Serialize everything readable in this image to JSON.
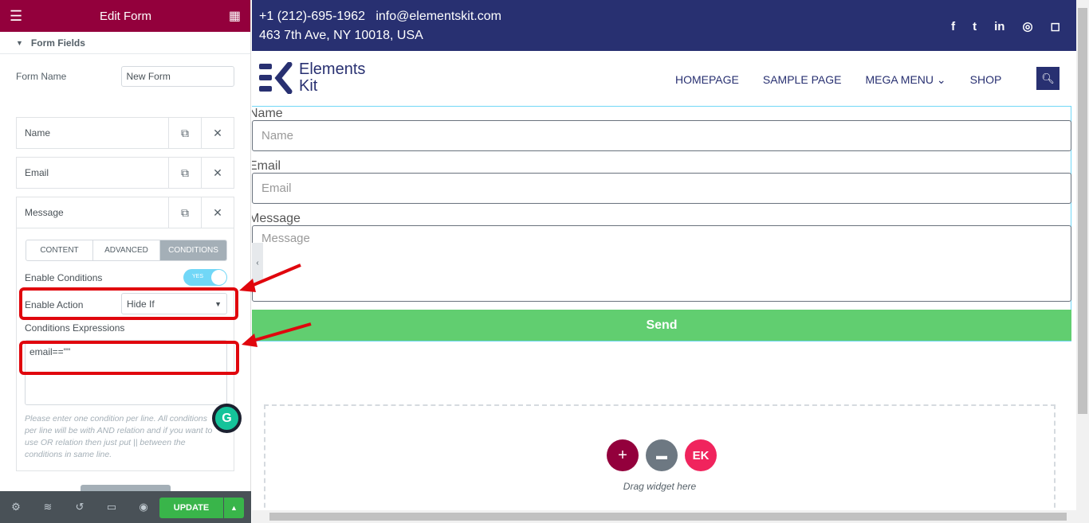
{
  "panel": {
    "title": "Edit Form",
    "section": "Form Fields",
    "form_name_label": "Form Name",
    "form_name_value": "New Form",
    "items": [
      {
        "label": "Name"
      },
      {
        "label": "Email"
      },
      {
        "label": "Message"
      }
    ],
    "tabs": [
      "CONTENT",
      "ADVANCED",
      "CONDITIONS"
    ],
    "active_tab": "CONDITIONS",
    "enable_conditions_label": "Enable Conditions",
    "toggle_text": "YES",
    "toggle_on": true,
    "enable_action_label": "Enable Action",
    "enable_action_value": "Hide If",
    "expressions_label": "Conditions Expressions",
    "expressions_value": "email==\"\"",
    "help": "Please enter one condition per line. All conditions per line will be with AND relation and if you want to use OR relation then just put || between the conditions in same line.",
    "update": "UPDATE"
  },
  "site": {
    "phone": "+1 (212)-695-1962",
    "email": "info@elementskit.com",
    "address": "463 7th Ave, NY 10018, USA",
    "logo_line1": "Elements",
    "logo_line2": "Kit",
    "menu": [
      "HOMEPAGE",
      "SAMPLE PAGE",
      "MEGA MENU",
      "SHOP"
    ],
    "form": {
      "name_label": "Name",
      "name_placeholder": "Name",
      "email_label": "Email",
      "email_placeholder": "Email",
      "message_label": "Message",
      "message_placeholder": "Message",
      "send": "Send"
    },
    "drag_text": "Drag widget here"
  },
  "colors": {
    "panel_header": "#93003c",
    "topbar": "#283071",
    "send": "#61ce70",
    "update": "#39b54a",
    "annotation": "#e0060d"
  }
}
